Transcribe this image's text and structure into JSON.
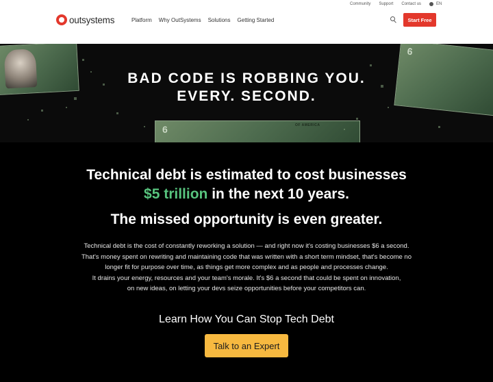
{
  "utility": {
    "links": [
      "Community",
      "Support",
      "Contact us"
    ],
    "language": "EN"
  },
  "brand": {
    "name": "outsystems",
    "color": "#e3382c"
  },
  "nav": {
    "items": [
      "Platform",
      "Why OutSystems",
      "Solutions",
      "Getting Started"
    ]
  },
  "header": {
    "start_label": "Start Free",
    "search_icon": "search-icon"
  },
  "hero": {
    "line1": "BAD CODE IS ROBBING YOU.",
    "line2": "EVERY. SECOND.",
    "bill_text": "OF AMERICA",
    "seal_numeral": "6"
  },
  "content": {
    "headline_l1": "Technical debt is estimated to cost businesses",
    "headline_l2_highlight": "$5 trillion",
    "headline_l2_rest": " in the next 10 years.",
    "headline_l3": "The missed opportunity is even greater.",
    "paragraph_lines": [
      "Technical debt is the cost of constantly reworking a solution — and right now it's costing businesses $6 a second.",
      "That's money spent on rewriting and maintaining code that was written with a short term mindset, that's become no",
      "longer fit for purpose over time, as things get more complex and as people and processes change.",
      "It drains your energy, resources and your team's morale. It's $6 a second that could be spent on innovation,",
      "on new ideas, on letting your devs seize opportunities before your competitors can."
    ],
    "cta_heading": "Learn How You Can Stop Tech Debt",
    "cta_label": "Talk to an Expert",
    "accent_green": "#58c47e",
    "cta_color": "#f7b940"
  }
}
